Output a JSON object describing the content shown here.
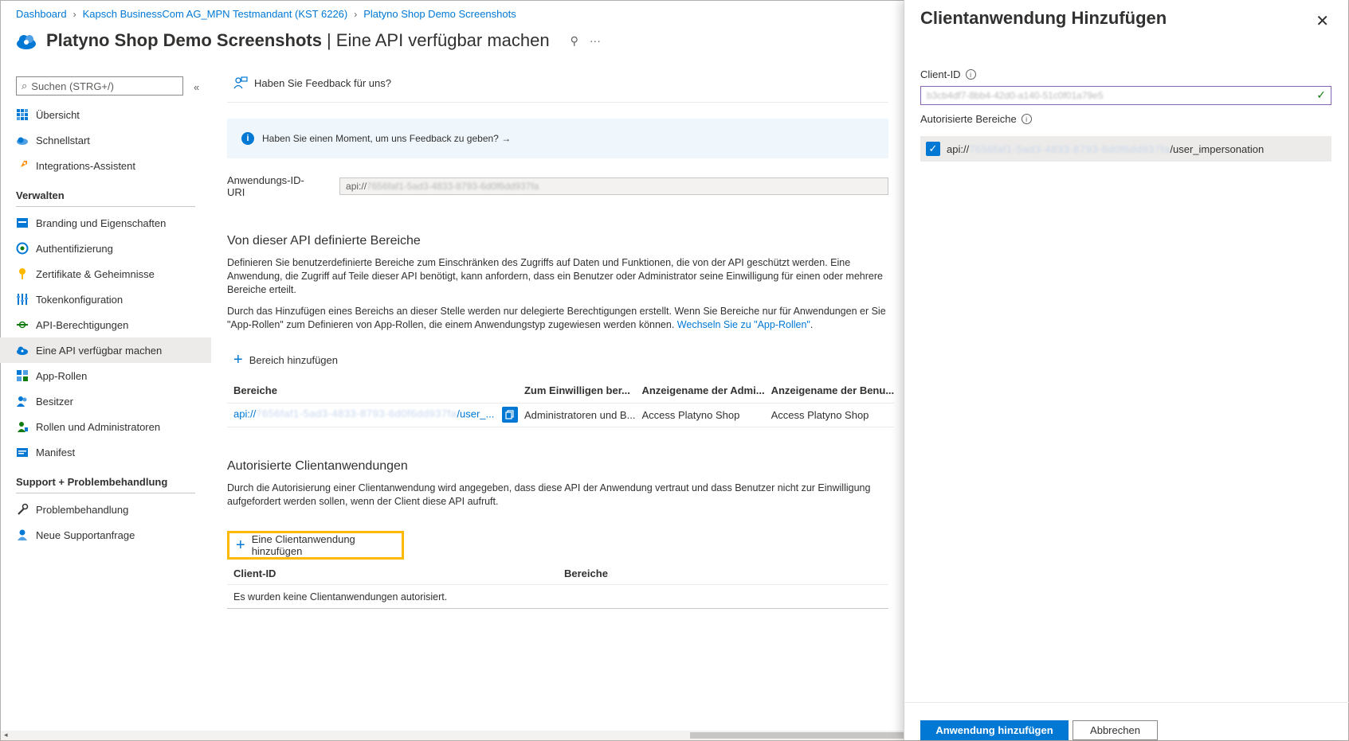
{
  "breadcrumb": [
    "Dashboard",
    "Kapsch BusinessCom AG_MPN Testmandant (KST 6226)",
    "Platyno Shop Demo Screenshots"
  ],
  "title": {
    "main": "Platyno Shop Demo Screenshots",
    "sub": "| Eine API verfügbar machen",
    "pin": "⚲",
    "more": "···"
  },
  "sidebar": {
    "search_placeholder": "Suchen (STRG+/)",
    "collapse": "«",
    "top_items": [
      {
        "label": "Übersicht",
        "icon": "grid-icon"
      },
      {
        "label": "Schnellstart",
        "icon": "cloud-icon"
      },
      {
        "label": "Integrations-Assistent",
        "icon": "rocket-icon"
      }
    ],
    "manage_header": "Verwalten",
    "manage_items": [
      {
        "label": "Branding und Eigenschaften",
        "icon": "branding-icon"
      },
      {
        "label": "Authentifizierung",
        "icon": "auth-icon"
      },
      {
        "label": "Zertifikate & Geheimnisse",
        "icon": "key-icon"
      },
      {
        "label": "Tokenkonfiguration",
        "icon": "token-icon"
      },
      {
        "label": "API-Berechtigungen",
        "icon": "api-perm-icon"
      },
      {
        "label": "Eine API verfügbar machen",
        "icon": "cloud-api-icon",
        "active": true
      },
      {
        "label": "App-Rollen",
        "icon": "app-roles-icon"
      },
      {
        "label": "Besitzer",
        "icon": "owners-icon"
      },
      {
        "label": "Rollen und Administratoren",
        "icon": "roles-icon"
      },
      {
        "label": "Manifest",
        "icon": "manifest-icon"
      }
    ],
    "support_header": "Support + Problembehandlung",
    "support_items": [
      {
        "label": "Problembehandlung",
        "icon": "wrench-icon"
      },
      {
        "label": "Neue Supportanfrage",
        "icon": "support-icon"
      }
    ]
  },
  "main": {
    "feedback": "Haben Sie Feedback für uns?",
    "info_bar": "Haben Sie einen Moment, um uns Feedback zu geben? →",
    "uri_label": "Anwendungs-ID-URI",
    "uri_prefix": "api://",
    "uri_blurred": "7656faf1-5ad3-4833-8793-6d0f6dd937fa",
    "scopes_title": "Von dieser API definierte Bereiche",
    "scopes_para1": "Definieren Sie benutzerdefinierte Bereiche zum Einschränken des Zugriffs auf Daten und Funktionen, die von der API geschützt werden. Eine Anwendung, die Zugriff auf Teile dieser API benötigt, kann anfordern, dass ein Benutzer oder Administrator seine Einwilligung für einen oder mehrere Bereiche erteilt.",
    "scopes_para2": "Durch das Hinzufügen eines Bereichs an dieser Stelle werden nur delegierte Berechtigungen erstellt. Wenn Sie Bereiche nur für Anwendungen er Sie \"App-Rollen\" zum Definieren von App-Rollen, die einem Anwendungstyp zugewiesen werden können.",
    "scopes_link": "Wechseln Sie zu \"App-Rollen\"",
    "add_scope": "Bereich hinzufügen",
    "scope_table": {
      "headers": [
        "Bereiche",
        "Zum Einwilligen ber...",
        "Anzeigename der Admi...",
        "Anzeigename der Benu..."
      ],
      "row": {
        "scope_prefix": "api://",
        "scope_blurred": "7656faf1-5ad3-4833-8793-6d0f6dd937fa",
        "scope_suffix": "/user_...",
        "consent": "Administratoren und B...",
        "admin_name": "Access Platyno Shop",
        "user_name": "Access Platyno Shop"
      }
    },
    "clients_title": "Autorisierte Clientanwendungen",
    "clients_para": "Durch die Autorisierung einer Clientanwendung wird angegeben, dass diese API der Anwendung vertraut und dass Benutzer nicht zur Einwilligung aufgefordert werden sollen, wenn der Client diese API aufruft.",
    "add_client": "Eine Clientanwendung hinzufügen",
    "client_table": {
      "headers": [
        "Client-ID",
        "Bereiche"
      ],
      "empty": "Es wurden keine Clientanwendungen autorisiert."
    }
  },
  "panel": {
    "title": "Clientanwendung Hinzufügen",
    "close": "✕",
    "client_id_label": "Client-ID",
    "client_id_value": "b3cb4df7-8bb4-42d0-a140-51c0f01a79e5",
    "scopes_label": "Autorisierte Bereiche",
    "scope_prefix": "api://",
    "scope_blurred": "7656faf1-5ad3-4833-8793-6d0f6dd937fa",
    "scope_suffix": "/user_impersonation",
    "scope_checked": true,
    "primary_button": "Anwendung hinzufügen",
    "secondary_button": "Abbrechen"
  },
  "colors": {
    "accent": "#0078d4",
    "highlight": "#ffb900",
    "input_border": "#8764b8"
  }
}
